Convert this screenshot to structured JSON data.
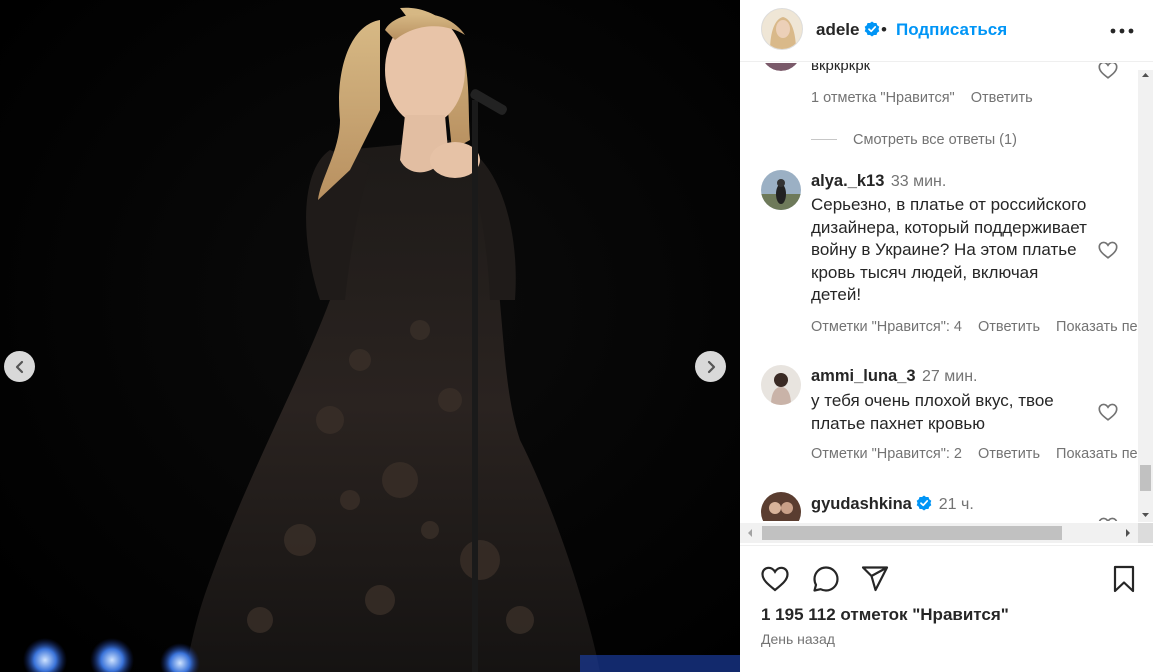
{
  "post": {
    "username": "adele",
    "follow_label": "Подписаться",
    "separator": "•"
  },
  "comments": {
    "partial_top_text": "вкркркрк",
    "reply_thread": {
      "likes": "1 отметка \"Нравится\"",
      "reply_label": "Ответить",
      "view_replies": "Смотреть все ответы (1)"
    },
    "items": [
      {
        "username": "alya._k13",
        "time": "33 мин.",
        "text": "Серьезно, в платье от российского дизайнера, который поддерживает войну в Украине? На этом платье кровь тысяч людей, включая детей!",
        "likes": "Отметки \"Нравится\": 4",
        "reply_label": "Ответить",
        "translate_label": "Показать перевод"
      },
      {
        "username": "ammi_luna_3",
        "time": "27 мин.",
        "text": "у тебя очень плохой вкус, твое платье пахнет кровью",
        "likes": "Отметки \"Нравится\": 2",
        "reply_label": "Ответить",
        "translate_label": "Показать перевод"
      },
      {
        "username": "gyudashkina",
        "time": "21 ч.",
        "verified": true
      }
    ]
  },
  "footer": {
    "likes_count": "1 195 112 отметок \"Нравится\"",
    "posted_ago": "День назад"
  },
  "colors": {
    "accent": "#0095f6",
    "verified": "#0095f6",
    "muted": "#737373"
  },
  "icons": [
    "more-options-icon",
    "verified-icon",
    "heart-icon",
    "comment-icon",
    "share-icon",
    "bookmark-icon",
    "chevron-left-icon",
    "chevron-right-icon"
  ]
}
